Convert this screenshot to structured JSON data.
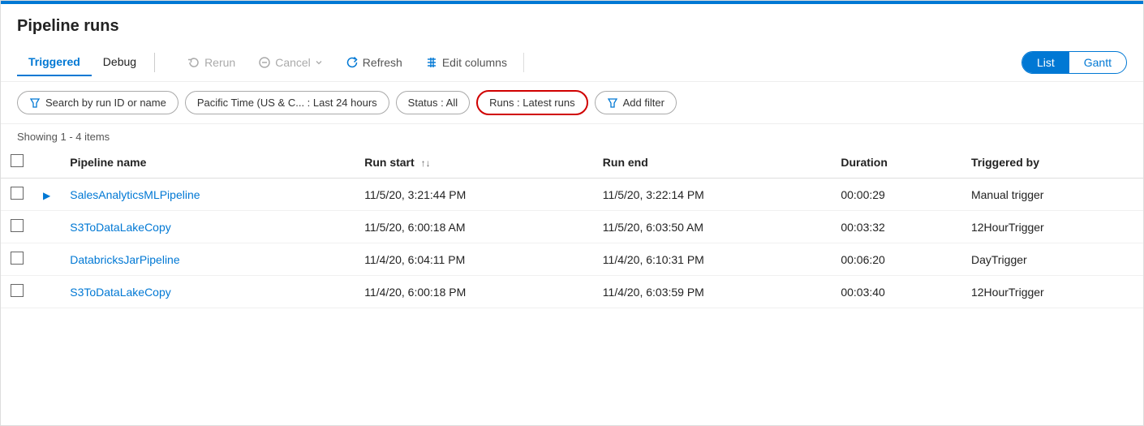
{
  "page": {
    "title": "Pipeline runs",
    "top_border_color": "#0078d4"
  },
  "toolbar": {
    "tabs": [
      {
        "id": "triggered",
        "label": "Triggered",
        "active": true
      },
      {
        "id": "debug",
        "label": "Debug",
        "active": false
      }
    ],
    "buttons": [
      {
        "id": "rerun",
        "label": "Rerun",
        "disabled": true,
        "icon": "rerun-icon"
      },
      {
        "id": "cancel",
        "label": "Cancel",
        "disabled": true,
        "icon": "cancel-icon",
        "dropdown": true
      },
      {
        "id": "refresh",
        "label": "Refresh",
        "disabled": false,
        "icon": "refresh-icon"
      },
      {
        "id": "edit-columns",
        "label": "Edit columns",
        "disabled": false,
        "icon": "columns-icon"
      }
    ],
    "view_toggle": [
      {
        "id": "list",
        "label": "List",
        "active": true
      },
      {
        "id": "gantt",
        "label": "Gantt",
        "active": false
      }
    ]
  },
  "filters": [
    {
      "id": "search",
      "type": "search",
      "placeholder": "Search by run ID or name",
      "icon": "filter-icon"
    },
    {
      "id": "time",
      "label": "Pacific Time (US & C... : Last 24 hours"
    },
    {
      "id": "status",
      "label": "Status : All"
    },
    {
      "id": "runs",
      "label": "Runs : Latest runs",
      "highlight": true
    },
    {
      "id": "add-filter",
      "label": "Add filter",
      "icon": "filter-icon"
    }
  ],
  "table": {
    "items_count_label": "Showing 1 - 4 items",
    "columns": [
      {
        "id": "pipeline-name",
        "label": "Pipeline name",
        "sortable": false
      },
      {
        "id": "run-start",
        "label": "Run start",
        "sortable": true
      },
      {
        "id": "run-end",
        "label": "Run end",
        "sortable": false
      },
      {
        "id": "duration",
        "label": "Duration",
        "sortable": false
      },
      {
        "id": "triggered-by",
        "label": "Triggered by",
        "sortable": false
      }
    ],
    "rows": [
      {
        "id": "row1",
        "has_expand": true,
        "pipeline_name": "SalesAnalyticsMLPipeline",
        "run_start": "11/5/20, 3:21:44 PM",
        "run_end": "11/5/20, 3:22:14 PM",
        "duration": "00:00:29",
        "triggered_by": "Manual trigger"
      },
      {
        "id": "row2",
        "has_expand": false,
        "pipeline_name": "S3ToDataLakeCopy",
        "run_start": "11/5/20, 6:00:18 AM",
        "run_end": "11/5/20, 6:03:50 AM",
        "duration": "00:03:32",
        "triggered_by": "12HourTrigger"
      },
      {
        "id": "row3",
        "has_expand": false,
        "pipeline_name": "DatabricksJarPipeline",
        "run_start": "11/4/20, 6:04:11 PM",
        "run_end": "11/4/20, 6:10:31 PM",
        "duration": "00:06:20",
        "triggered_by": "DayTrigger"
      },
      {
        "id": "row4",
        "has_expand": false,
        "pipeline_name": "S3ToDataLakeCopy",
        "run_start": "11/4/20, 6:00:18 PM",
        "run_end": "11/4/20, 6:03:59 PM",
        "duration": "00:03:40",
        "triggered_by": "12HourTrigger"
      }
    ]
  }
}
